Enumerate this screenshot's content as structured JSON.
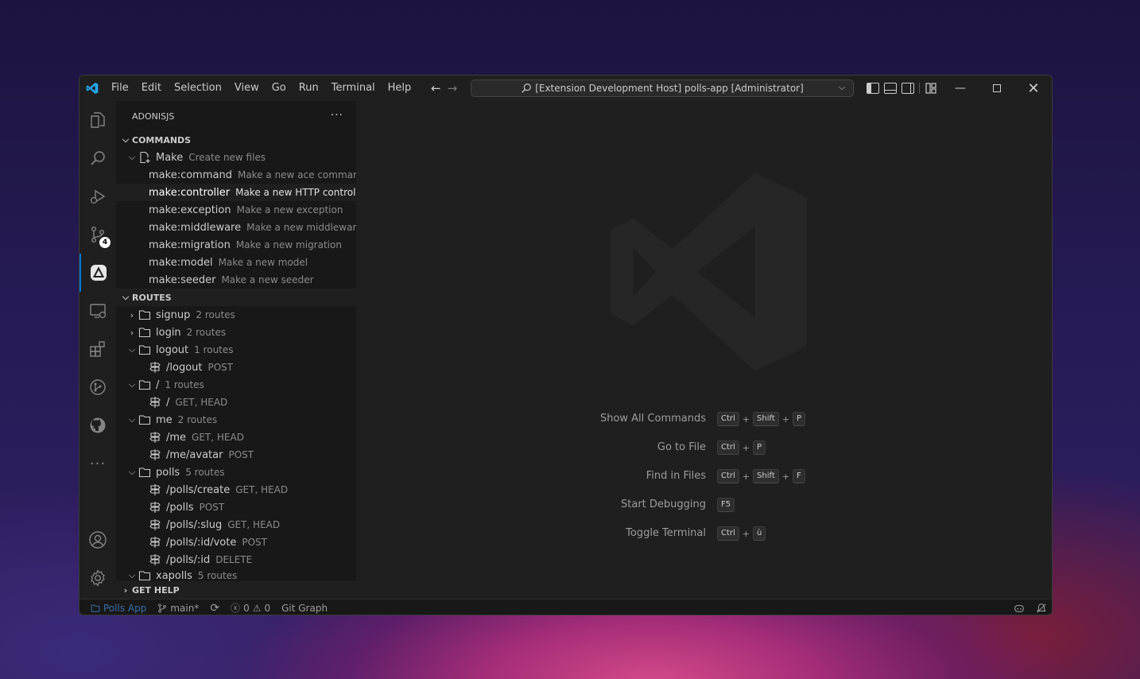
{
  "titlebar": {
    "menu": [
      "File",
      "Edit",
      "Selection",
      "View",
      "Go",
      "Run",
      "Terminal",
      "Help"
    ],
    "command_center": "[Extension Development Host] polls-app [Administrator]"
  },
  "sidebar": {
    "title": "ADONISJS",
    "commands_header": "COMMANDS",
    "make_group": {
      "label": "Make",
      "desc": "Create new files"
    },
    "commands": [
      {
        "label": "make:command",
        "desc": "Make a new ace command"
      },
      {
        "label": "make:controller",
        "desc": "Make a new HTTP controller"
      },
      {
        "label": "make:exception",
        "desc": "Make a new exception"
      },
      {
        "label": "make:middleware",
        "desc": "Make a new middleware"
      },
      {
        "label": "make:migration",
        "desc": "Make a new migration"
      },
      {
        "label": "make:model",
        "desc": "Make a new model"
      },
      {
        "label": "make:seeder",
        "desc": "Make a new seeder"
      }
    ],
    "routes_header": "ROUTES",
    "routes": [
      {
        "label": "signup",
        "desc": "2 routes"
      },
      {
        "label": "login",
        "desc": "2 routes"
      },
      {
        "label": "logout",
        "desc": "1 routes"
      },
      {
        "label": "/logout",
        "desc": "POST"
      },
      {
        "label": "/",
        "desc": "1 routes"
      },
      {
        "label": "/",
        "desc": "GET, HEAD"
      },
      {
        "label": "me",
        "desc": "2 routes"
      },
      {
        "label": "/me",
        "desc": "GET, HEAD"
      },
      {
        "label": "/me/avatar",
        "desc": "POST"
      },
      {
        "label": "polls",
        "desc": "5 routes"
      },
      {
        "label": "/polls/create",
        "desc": "GET, HEAD"
      },
      {
        "label": "/polls",
        "desc": "POST"
      },
      {
        "label": "/polls/:slug",
        "desc": "GET, HEAD"
      },
      {
        "label": "/polls/:id/vote",
        "desc": "POST"
      },
      {
        "label": "/polls/:id",
        "desc": "DELETE"
      },
      {
        "label": "xapolls",
        "desc": "5 routes"
      }
    ],
    "help_header": "GET HELP",
    "source_control_badge": "4"
  },
  "editor": {
    "shortcuts": [
      {
        "label": "Show All Commands",
        "keys": [
          "Ctrl",
          "Shift",
          "P"
        ]
      },
      {
        "label": "Go to File",
        "keys": [
          "Ctrl",
          "P"
        ]
      },
      {
        "label": "Find in Files",
        "keys": [
          "Ctrl",
          "Shift",
          "F"
        ]
      },
      {
        "label": "Start Debugging",
        "keys": [
          "F5"
        ]
      },
      {
        "label": "Toggle Terminal",
        "keys": [
          "Ctrl",
          "ù"
        ]
      }
    ]
  },
  "statusbar": {
    "project": "Polls App",
    "branch": "main*",
    "errors": "0",
    "warnings": "0",
    "git_graph": "Git Graph"
  },
  "colors": {
    "accent": "#0078d4",
    "background": "#1f1f1f",
    "sidebar": "#181818"
  }
}
